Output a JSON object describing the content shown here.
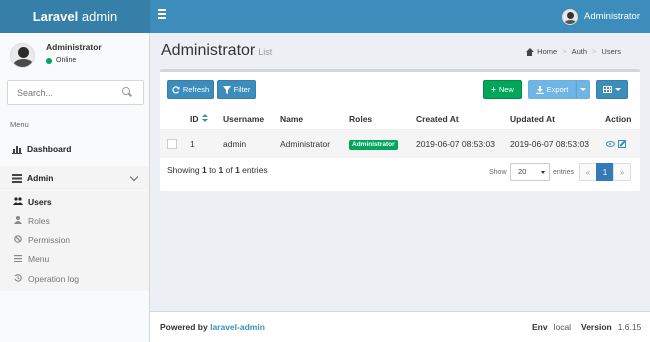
{
  "header": {
    "logo_bold": "Laravel",
    "logo_light": " admin",
    "user_name": "Administrator"
  },
  "sidebar": {
    "user_name": "Administrator",
    "status": "Online",
    "search_placeholder": "Search...",
    "menu_header": "Menu",
    "items": [
      {
        "label": "Dashboard",
        "icon": "bar-chart-icon"
      },
      {
        "label": "Admin",
        "icon": "tasks-icon"
      }
    ],
    "subitems": [
      {
        "label": "Users",
        "icon": "users-icon",
        "active": true
      },
      {
        "label": "Roles",
        "icon": "user-icon",
        "active": false
      },
      {
        "label": "Permission",
        "icon": "ban-icon",
        "active": false
      },
      {
        "label": "Menu",
        "icon": "bars-icon",
        "active": false
      },
      {
        "label": "Operation log",
        "icon": "history-icon",
        "active": false
      }
    ]
  },
  "content": {
    "title": "Administrator",
    "subtitle": "List",
    "breadcrumb": [
      "Home",
      "Auth",
      "Users"
    ]
  },
  "toolbar": {
    "refresh": "Refresh",
    "filter": "Filter",
    "new": "New",
    "export": "Export"
  },
  "table": {
    "columns": [
      "ID",
      "Username",
      "Name",
      "Roles",
      "Created At",
      "Updated At",
      "Action"
    ],
    "rows": [
      {
        "id": "1",
        "username": "admin",
        "name": "Administrator",
        "role": "Administrator",
        "created_at": "2019-06-07 08:53:03",
        "updated_at": "2019-06-07 08:53:03"
      }
    ]
  },
  "pagination": {
    "showing_prefix": "Showing ",
    "from": "1",
    "to_text": " to ",
    "to": "1",
    "of_text": " of ",
    "total": "1",
    "suffix": " entries",
    "show_label": "Show",
    "per_page": "20",
    "entries_label": "entries",
    "prev": "«",
    "current": "1",
    "next": "»"
  },
  "footer": {
    "powered_by": "Powered by ",
    "powered_link": "laravel-admin",
    "env_label": "Env",
    "env_value": "local",
    "version_label": "Version",
    "version_value": "1.6.15"
  },
  "colors": {
    "header": "#3c8dbc",
    "logo_bg": "#367fa9",
    "success": "#00a65a",
    "export": "#6fb5e6"
  }
}
